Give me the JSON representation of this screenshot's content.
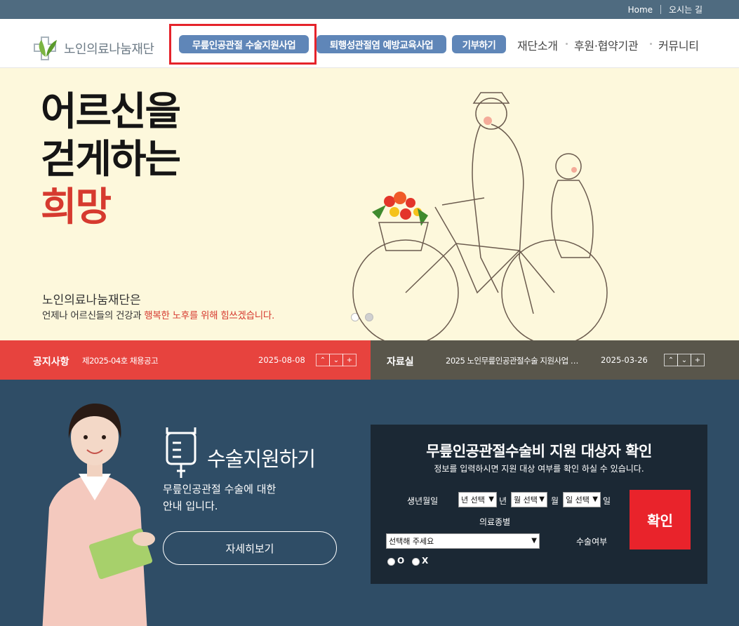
{
  "topbar": {
    "home": "Home",
    "directions": "오시는 길"
  },
  "header": {
    "logo_text": "노인의료나눔재단",
    "nav_buttons": [
      "무릎인공관절 수술지원사업",
      "퇴행성관절염 예방교육사업",
      "기부하기"
    ],
    "nav_links": [
      "재단소개",
      "후원·협약기관",
      "커뮤니티"
    ]
  },
  "hero": {
    "title_lines": [
      "어르신을",
      "걷게하는",
      "희망"
    ],
    "org": "노인의료나눔재단은",
    "sub_prefix": "언제나 어르신들의 건강과 ",
    "sub_red": "행복한 노후를 위해 힘쓰겠습니다.",
    "colors": {
      "accent": "#d63a2f",
      "background": "#fdf8dc"
    }
  },
  "notices": {
    "left": {
      "title": "공지사항",
      "text": "제2025-04호 채용공고",
      "date": "2025-08-08",
      "controls": [
        "⌃",
        "⌄",
        "+"
      ]
    },
    "right": {
      "title": "자료실",
      "text": "2025 노인무릎인공관절수술 지원사업 …",
      "date": "2025-03-26",
      "controls": [
        "⌃",
        "⌄",
        "+"
      ]
    }
  },
  "surgery": {
    "title": "수술지원하기",
    "desc_lines": [
      "무릎인공관절 수술에 대한",
      "안내 입니다."
    ],
    "more_button": "자세히보기"
  },
  "check": {
    "title": "무릎인공관절수술비 지원 대상자 확인",
    "subtitle": "정보를 입력하시면 지원 대상 여부를 확인 하실 수 있습니다.",
    "birth_label": "생년월일",
    "year_select": "년 선택",
    "year_unit": "년",
    "month_select": "월 선택",
    "month_unit": "월",
    "day_select": "일 선택",
    "day_unit": "일",
    "insurance_label": "의료종별",
    "insurance_select": "선택해 주세요",
    "surgery_label": "수술여부",
    "radio_o": "O",
    "radio_x": "X",
    "confirm": "확인"
  }
}
